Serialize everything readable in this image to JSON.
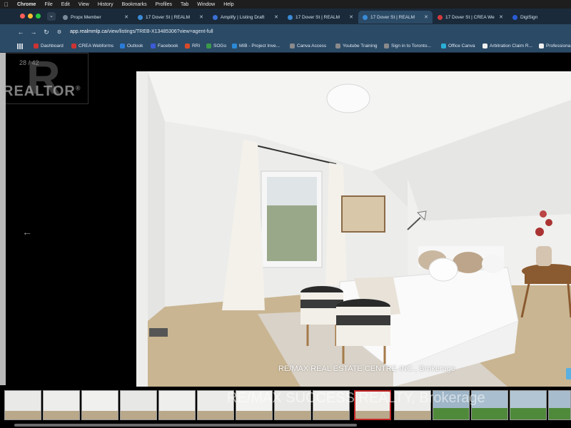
{
  "menubar": {
    "apple": "",
    "items": [
      "Chrome",
      "File",
      "Edit",
      "View",
      "History",
      "Bookmarks",
      "Profiles",
      "Tab",
      "Window",
      "Help"
    ]
  },
  "tabs": [
    {
      "label": "Propx Member",
      "active": false
    },
    {
      "label": "17 Dover St | REALM",
      "active": false
    },
    {
      "label": "Amplify | Listing Draft",
      "active": false
    },
    {
      "label": "17 Dover St | REALM",
      "active": false
    },
    {
      "label": "17 Dover St | REALM",
      "active": true
    },
    {
      "label": "17 Dover St | CREA We",
      "active": false
    },
    {
      "label": "DigiSign",
      "active": false
    }
  ],
  "address": {
    "host": "app.realmmlp.ca",
    "path": "/view/listings/TREB-X13485306?view=agent-full"
  },
  "bookmarks": [
    "Dashboard",
    "CREA Webforms",
    "Outlook",
    "Facebook",
    "RRI",
    "SOGo",
    "MIB - Project Inve...",
    "Canva Access",
    "Youtube Training",
    "Sign in to Toronto...",
    "Office Canva",
    "Arbitration Claim R...",
    "Professiona"
  ],
  "gallery": {
    "counter": "28 / 42",
    "logo_text": "REALTOR",
    "logo_mark": "®",
    "prev_arrow": "←",
    "photo_credit": "RE/MAX REAL ESTATE CENTRE INC., Brokerage",
    "thumb_credit": "RE/MAX SUCCESS REALTY, Brokerage",
    "thumbnails": 15,
    "active_thumbnail": 9
  },
  "colors": {
    "tab_active": "#2b4a66",
    "tab_strip": "#1a2a3a",
    "thumb_active_border": "#c62828"
  }
}
